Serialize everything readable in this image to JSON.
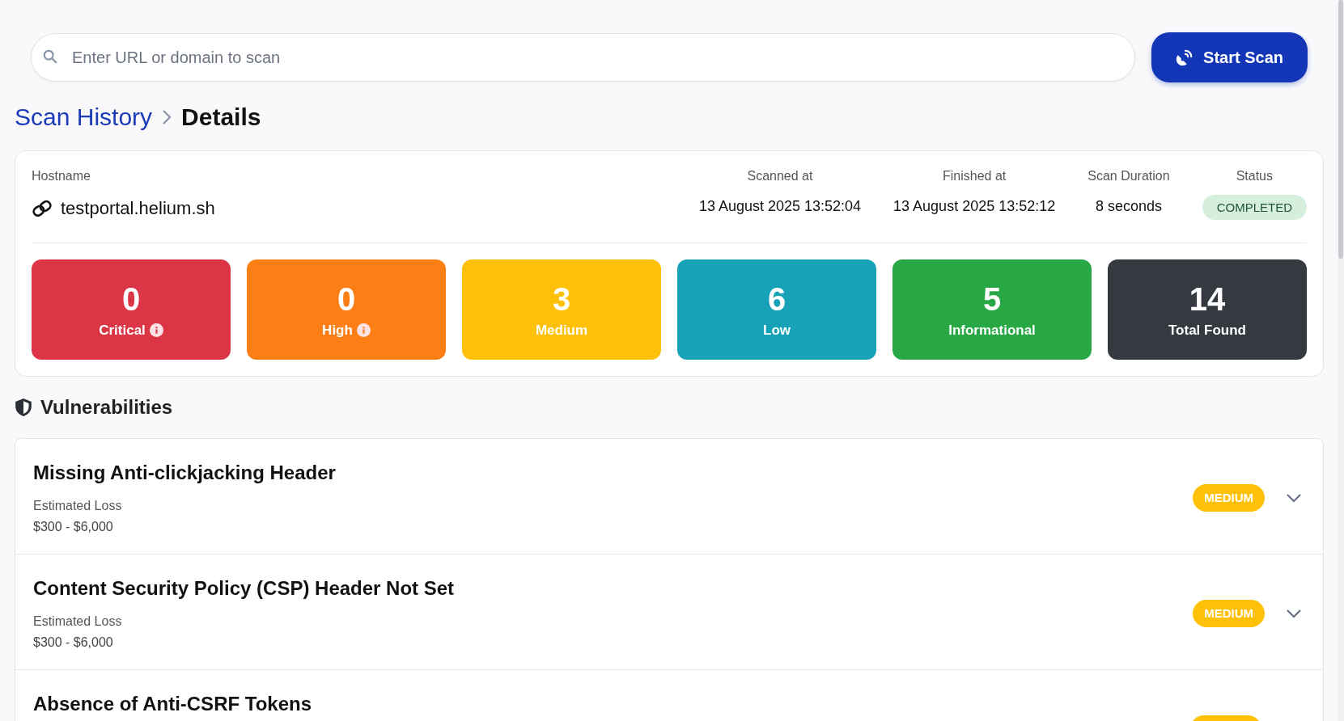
{
  "search": {
    "placeholder": "Enter URL or domain to scan"
  },
  "scan_button": {
    "label": "Start Scan"
  },
  "breadcrumb": [
    {
      "label": "Scan History",
      "kind": "link"
    },
    {
      "label": "Details",
      "kind": "current"
    }
  ],
  "summary": {
    "hostname_label": "Hostname",
    "hostname": "testportal.helium.sh",
    "fields": [
      {
        "label": "Scanned at",
        "value": "13 August 2025 13:52:04",
        "kind": "text"
      },
      {
        "label": "Finished at",
        "value": "13 August 2025 13:52:12",
        "kind": "text"
      },
      {
        "label": "Scan Duration",
        "value": "8 seconds",
        "kind": "text"
      },
      {
        "label": "Status",
        "value": "COMPLETED",
        "kind": "status"
      }
    ],
    "counts": [
      {
        "value": "0",
        "label": "Critical",
        "kind": "critical",
        "info": true
      },
      {
        "value": "0",
        "label": "High",
        "kind": "high",
        "info": true
      },
      {
        "value": "3",
        "label": "Medium",
        "kind": "medium",
        "info": false
      },
      {
        "value": "6",
        "label": "Low",
        "kind": "low",
        "info": false
      },
      {
        "value": "5",
        "label": "Informational",
        "kind": "info",
        "info": false
      },
      {
        "value": "14",
        "label": "Total Found",
        "kind": "total",
        "info": false
      }
    ]
  },
  "vulnerabilities": {
    "title": "Vulnerabilities",
    "items": [
      {
        "title": "Missing Anti-clickjacking Header",
        "loss_label": "Estimated Loss",
        "loss": "$300 - $6,000",
        "severity": "MEDIUM",
        "kind": "medium",
        "expanded": false
      },
      {
        "title": "Content Security Policy (CSP) Header Not Set",
        "loss_label": "Estimated Loss",
        "loss": "$300 - $6,000",
        "severity": "MEDIUM",
        "kind": "medium",
        "expanded": false
      },
      {
        "title": "Absence of Anti-CSRF Tokens",
        "kind": "medium"
      }
    ]
  }
}
